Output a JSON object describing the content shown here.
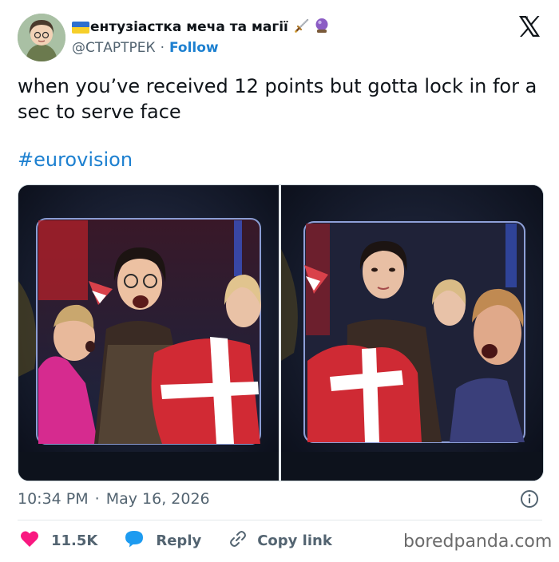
{
  "author": {
    "display_name": "ентузіастка меча та магії",
    "flag_icon": "ukraine-flag-icon",
    "emoji_icons": [
      "dagger-emoji",
      "crystal-ball-emoji"
    ],
    "handle": "@СТАРТРЕК",
    "follow_label": "Follow"
  },
  "tweet": {
    "text": "when you’ve received 12 points but gotta lock in for a sec to serve face",
    "hashtag": "#eurovision",
    "media_alt": "two photos side by side"
  },
  "meta": {
    "time": "10:34 PM",
    "separator": "·",
    "date": "May 16, 2026"
  },
  "actions": {
    "like_count": "11.5K",
    "reply_label": "Reply",
    "copy_label": "Copy link"
  },
  "watermark": "boredpanda.com",
  "colors": {
    "link": "#1d80d0",
    "like": "#f91880",
    "reply": "#1d9bf0",
    "muted": "#536471",
    "text": "#0f1419"
  }
}
